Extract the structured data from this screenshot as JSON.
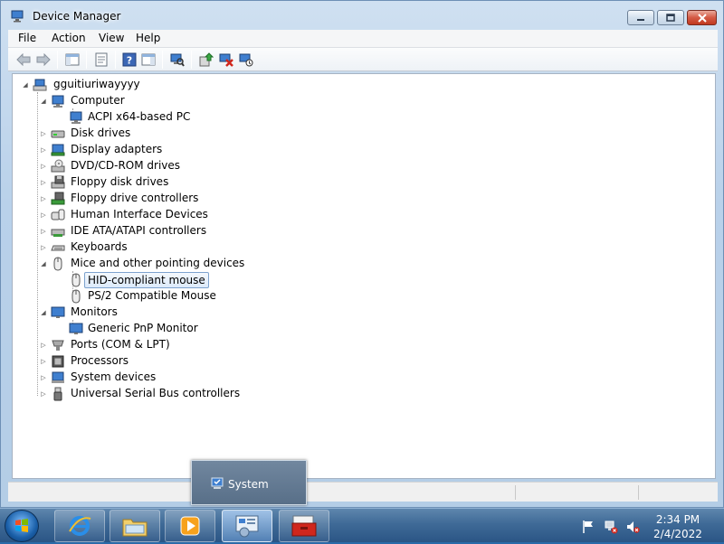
{
  "window": {
    "title": "Device Manager"
  },
  "menu": [
    "File",
    "Action",
    "View",
    "Help"
  ],
  "toolbar": {
    "buttons": [
      {
        "icon": "back-arrow-icon"
      },
      {
        "icon": "forward-arrow-icon"
      },
      {
        "icon": "show-hide-console-tree-icon"
      },
      {
        "icon": "properties-icon"
      },
      {
        "icon": "help-icon"
      },
      {
        "icon": "action-pane-icon"
      },
      {
        "icon": "scan-hardware-icon"
      },
      {
        "icon": "update-driver-icon"
      },
      {
        "icon": "uninstall-device-icon"
      },
      {
        "icon": "disable-device-icon"
      }
    ]
  },
  "tree": {
    "root": "gguitiuriwayyyy",
    "nodes": [
      {
        "label": "Computer",
        "icon": "computer-icon",
        "expanded": true,
        "children": [
          "ACPI x64-based PC"
        ]
      },
      {
        "label": "Disk drives",
        "icon": "disk-drive-icon",
        "expanded": false
      },
      {
        "label": "Display adapters",
        "icon": "display-adapter-icon",
        "expanded": false
      },
      {
        "label": "DVD/CD-ROM drives",
        "icon": "dvd-drive-icon",
        "expanded": false
      },
      {
        "label": "Floppy disk drives",
        "icon": "floppy-icon",
        "expanded": false
      },
      {
        "label": "Floppy drive controllers",
        "icon": "floppy-controller-icon",
        "expanded": false
      },
      {
        "label": "Human Interface Devices",
        "icon": "hid-icon",
        "expanded": false
      },
      {
        "label": "IDE ATA/ATAPI controllers",
        "icon": "ide-controller-icon",
        "expanded": false
      },
      {
        "label": "Keyboards",
        "icon": "keyboard-icon",
        "expanded": false
      },
      {
        "label": "Mice and other pointing devices",
        "icon": "mouse-icon",
        "expanded": true,
        "children": [
          "HID-compliant mouse",
          "PS/2 Compatible Mouse"
        ]
      },
      {
        "label": "Monitors",
        "icon": "monitor-icon",
        "expanded": true,
        "children": [
          "Generic PnP Monitor"
        ]
      },
      {
        "label": "Ports (COM & LPT)",
        "icon": "port-icon",
        "expanded": false
      },
      {
        "label": "Processors",
        "icon": "processor-icon",
        "expanded": false
      },
      {
        "label": "System devices",
        "icon": "system-device-icon",
        "expanded": false
      },
      {
        "label": "Universal Serial Bus controllers",
        "icon": "usb-icon",
        "expanded": false
      }
    ],
    "selected": "HID-compliant mouse"
  },
  "taskbar": {
    "popup_label": "System",
    "apps": [
      {
        "icon": "internet-explorer-icon"
      },
      {
        "icon": "file-explorer-icon"
      },
      {
        "icon": "media-player-icon"
      },
      {
        "icon": "control-panel-icon"
      },
      {
        "icon": "toolbox-icon"
      }
    ],
    "clock_time": "2:34 PM",
    "clock_date": "2/4/2022"
  },
  "colors": {
    "selection_border": "#7da2ce",
    "taskbar": "#3f6a97",
    "close_button": "#c0391f"
  }
}
